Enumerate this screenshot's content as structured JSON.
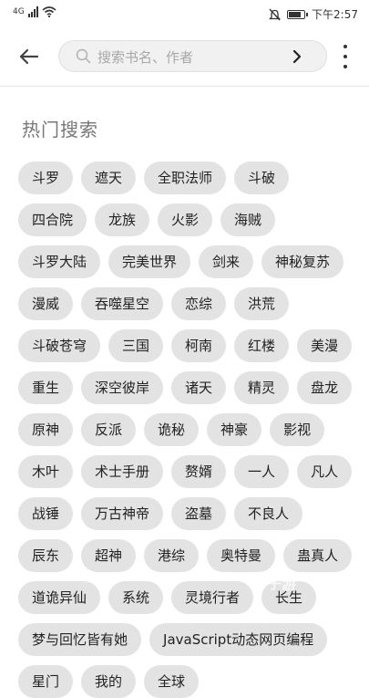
{
  "status_bar": {
    "left_label": "4G",
    "time": "下午2:57"
  },
  "search": {
    "placeholder": "搜索书名、作者",
    "value": ""
  },
  "section": {
    "title": "热门搜索"
  },
  "hot_tags": [
    "斗罗",
    "遮天",
    "全职法师",
    "斗破",
    "四合院",
    "龙族",
    "火影",
    "海贼",
    "斗罗大陆",
    "完美世界",
    "剑来",
    "神秘复苏",
    "漫威",
    "吞噬星空",
    "恋综",
    "洪荒",
    "斗破苍穹",
    "三国",
    "柯南",
    "红楼",
    "美漫",
    "重生",
    "深空彼岸",
    "诸天",
    "精灵",
    "盘龙",
    "原神",
    "反派",
    "诡秘",
    "神豪",
    "影视",
    "木叶",
    "术士手册",
    "赘婿",
    "一人",
    "凡人",
    "战锤",
    "万古神帝",
    "盗墓",
    "不良人",
    "辰东",
    "超神",
    "港综",
    "奥特曼",
    "蛊真人",
    "道诡异仙",
    "系统",
    "灵境行者",
    "长生",
    "梦与回忆皆有她",
    "JavaScript动态网页编程",
    "星门",
    "我的",
    "全球"
  ],
  "watermark": "7子游"
}
